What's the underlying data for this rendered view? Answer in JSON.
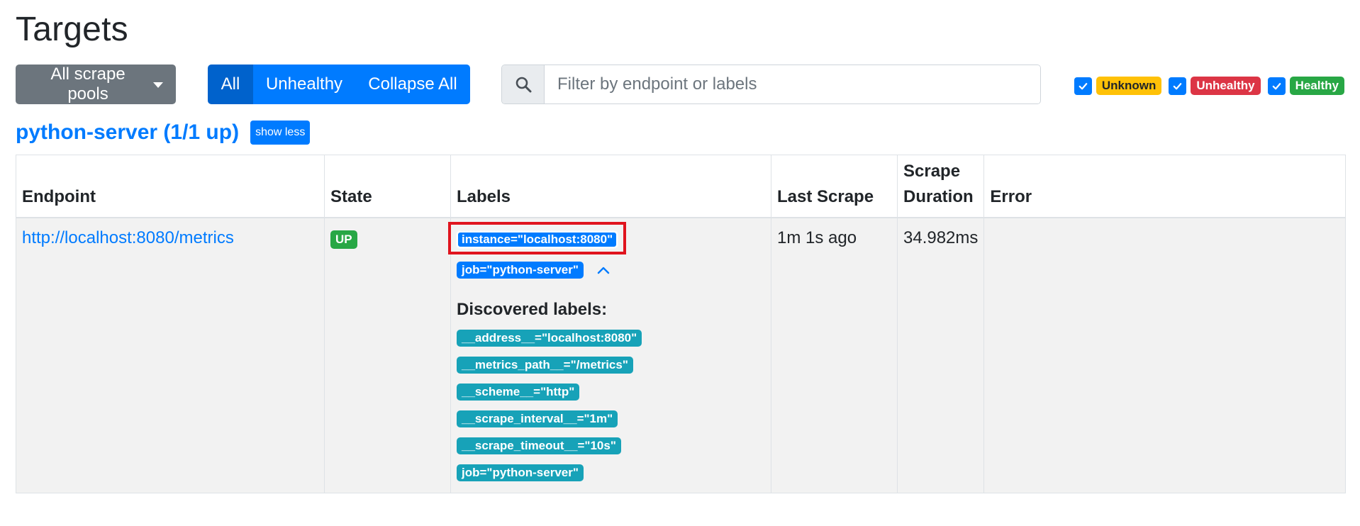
{
  "page": {
    "title": "Targets"
  },
  "toolbar": {
    "pool_select": "All scrape pools",
    "filter_buttons": [
      "All",
      "Unhealthy",
      "Collapse All"
    ],
    "search_placeholder": "Filter by endpoint or labels",
    "health_filters": [
      "Unknown",
      "Unhealthy",
      "Healthy"
    ]
  },
  "pool": {
    "name": "python-server (1/1 up)",
    "toggle_label": "show less"
  },
  "table": {
    "headers": {
      "endpoint": "Endpoint",
      "state": "State",
      "labels": "Labels",
      "last_scrape": "Last Scrape",
      "scrape_duration_1": "Scrape",
      "scrape_duration_2": "Duration",
      "error": "Error"
    },
    "rows": [
      {
        "endpoint": "http://localhost:8080/metrics",
        "state": "UP",
        "labels": [
          "instance=\"localhost:8080\"",
          "job=\"python-server\""
        ],
        "discovered_title": "Discovered labels:",
        "discovered": [
          "__address__=\"localhost:8080\"",
          "__metrics_path__=\"/metrics\"",
          "__scheme__=\"http\"",
          "__scrape_interval__=\"1m\"",
          "__scrape_timeout__=\"10s\"",
          "job=\"python-server\""
        ],
        "last_scrape": "1m 1s ago",
        "scrape_duration": "34.982ms",
        "error": ""
      }
    ]
  },
  "colors": {
    "primary": "#007bff",
    "secondary": "#6c757d",
    "success": "#28a745",
    "danger": "#dc3545",
    "warning": "#ffc107",
    "info": "#17a2b8",
    "highlight_box": "#e0141e"
  }
}
